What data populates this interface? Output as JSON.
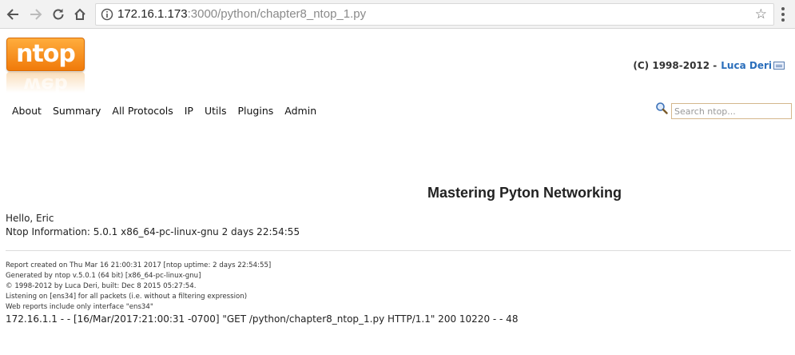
{
  "browser": {
    "url_host": "172.16.1.173",
    "url_rest": ":3000/python/chapter8_ntop_1.py",
    "icons": [
      "back-arrow-icon",
      "forward-arrow-icon",
      "reload-icon",
      "home-icon",
      "info-icon",
      "star-icon",
      "menu-icon"
    ]
  },
  "header": {
    "logo_text": "ntop",
    "logo_reflection_text": "web",
    "copyright_prefix": "(C) 1998-2012 -",
    "author_link": "Luca Deri",
    "accent_color": "#f58a1f",
    "link_color": "#2a6ebb"
  },
  "menu": {
    "items": [
      {
        "label": "About"
      },
      {
        "label": "Summary"
      },
      {
        "label": "All Protocols"
      },
      {
        "label": "IP"
      },
      {
        "label": "Utils"
      },
      {
        "label": "Plugins"
      },
      {
        "label": "Admin"
      }
    ]
  },
  "search": {
    "value": "",
    "placeholder": "Search ntop..."
  },
  "main": {
    "title": "Mastering Pyton Networking",
    "greeting": "Hello, Eric",
    "info": "Ntop Information: 5.0.1 x86_64-pc-linux-gnu 2 days 22:54:55"
  },
  "footer": {
    "lines": [
      "Report created on Thu Mar 16 21:00:31 2017 [ntop uptime: 2 days 22:54:55]",
      "Generated by ntop v.5.0.1 (64 bit) [x86_64-pc-linux-gnu]",
      "© 1998-2012 by Luca Deri, built: Dec 8 2015 05:27:54.",
      "Listening on [ens34] for all packets (i.e. without a filtering expression)",
      "Web reports include only interface \"ens34\""
    ],
    "access_log": "172.16.1.1 - - [16/Mar/2017:21:00:31 -0700] \"GET /python/chapter8_ntop_1.py HTTP/1.1\" 200 10220 - - 48"
  }
}
